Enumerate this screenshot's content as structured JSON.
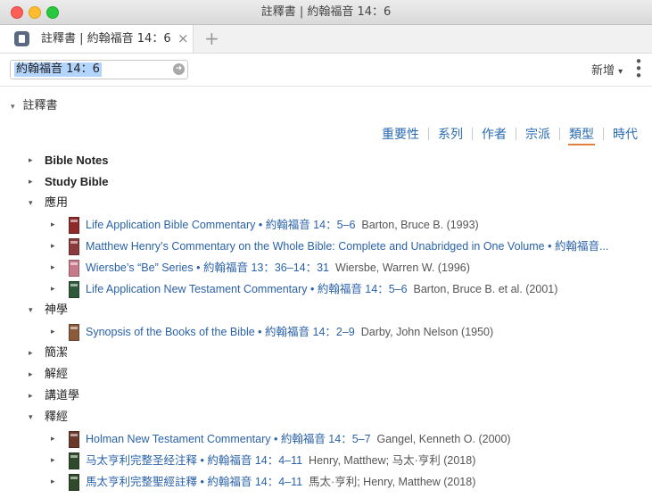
{
  "window": {
    "title": "註釋書 | 約翰福音 14：6"
  },
  "tab": {
    "title": "註釋書 | 約翰福音 14：6",
    "close": "×",
    "new_tab": "+"
  },
  "toolbar": {
    "reference_value": "約翰福音 14：6",
    "go_icon": "arrow-right-icon",
    "add_label": "新增",
    "add_arrow": "▾",
    "more": "⋮"
  },
  "section": {
    "title": "註釋書",
    "expand": "▾"
  },
  "sort_options": [
    {
      "label": "重要性",
      "active": false
    },
    {
      "label": "系列",
      "active": false
    },
    {
      "label": "作者",
      "active": false
    },
    {
      "label": "宗派",
      "active": false
    },
    {
      "label": "類型",
      "active": true
    },
    {
      "label": "時代",
      "active": false
    }
  ],
  "categories": [
    {
      "label": "Bible Notes",
      "expanded": false,
      "bold": true,
      "items": []
    },
    {
      "label": "Study Bible",
      "expanded": false,
      "bold": true,
      "items": []
    },
    {
      "label": "應用",
      "expanded": true,
      "bold": false,
      "items": [
        {
          "title": "Life Application Bible Commentary",
          "ref": "約翰福音 14：5–6",
          "author": "Barton, Bruce B. (1993)",
          "cover": "#8f2a2a"
        },
        {
          "title": "Matthew Henry’s Commentary on the Whole Bible: Complete and Unabridged in One Volume",
          "ref": "約翰福音...",
          "author": "",
          "cover": "#8b3b3b"
        },
        {
          "title": "Wiersbe’s “Be” Series",
          "ref": "約翰福音 13：36–14：31",
          "author": "Wiersbe, Warren W. (1996)",
          "cover": "#c77a8a"
        },
        {
          "title": "Life Application New Testament Commentary",
          "ref": "約翰福音 14：5–6",
          "author": "Barton, Bruce B. et al. (2001)",
          "cover": "#2e5a3a"
        }
      ]
    },
    {
      "label": "神學",
      "expanded": true,
      "bold": false,
      "items": [
        {
          "title": "Synopsis of the Books of the Bible",
          "ref": "約翰福音 14：2–9",
          "author": "Darby, John Nelson (1950)",
          "cover": "#8a5a3a"
        }
      ]
    },
    {
      "label": "簡潔",
      "expanded": false,
      "bold": false,
      "items": []
    },
    {
      "label": "解經",
      "expanded": false,
      "bold": false,
      "items": []
    },
    {
      "label": "講道學",
      "expanded": false,
      "bold": false,
      "items": []
    },
    {
      "label": "釋經",
      "expanded": true,
      "bold": false,
      "items": [
        {
          "title": "Holman New Testament Commentary",
          "ref": "約翰福音 14：5–7",
          "author": "Gangel, Kenneth O. (2000)",
          "cover": "#6b3a2a"
        },
        {
          "title": "马太亨利完整圣经注释",
          "ref": "約翰福音 14：4–11",
          "author": "Henry, Matthew; 马太·亨利 (2018)",
          "cover": "#2f4a2a"
        },
        {
          "title": "馬太亨利完整聖經註釋",
          "ref": "約翰福音 14：4–11",
          "author": "馬太·亨利; Henry, Matthew (2018)",
          "cover": "#2f4a2a"
        }
      ]
    }
  ]
}
